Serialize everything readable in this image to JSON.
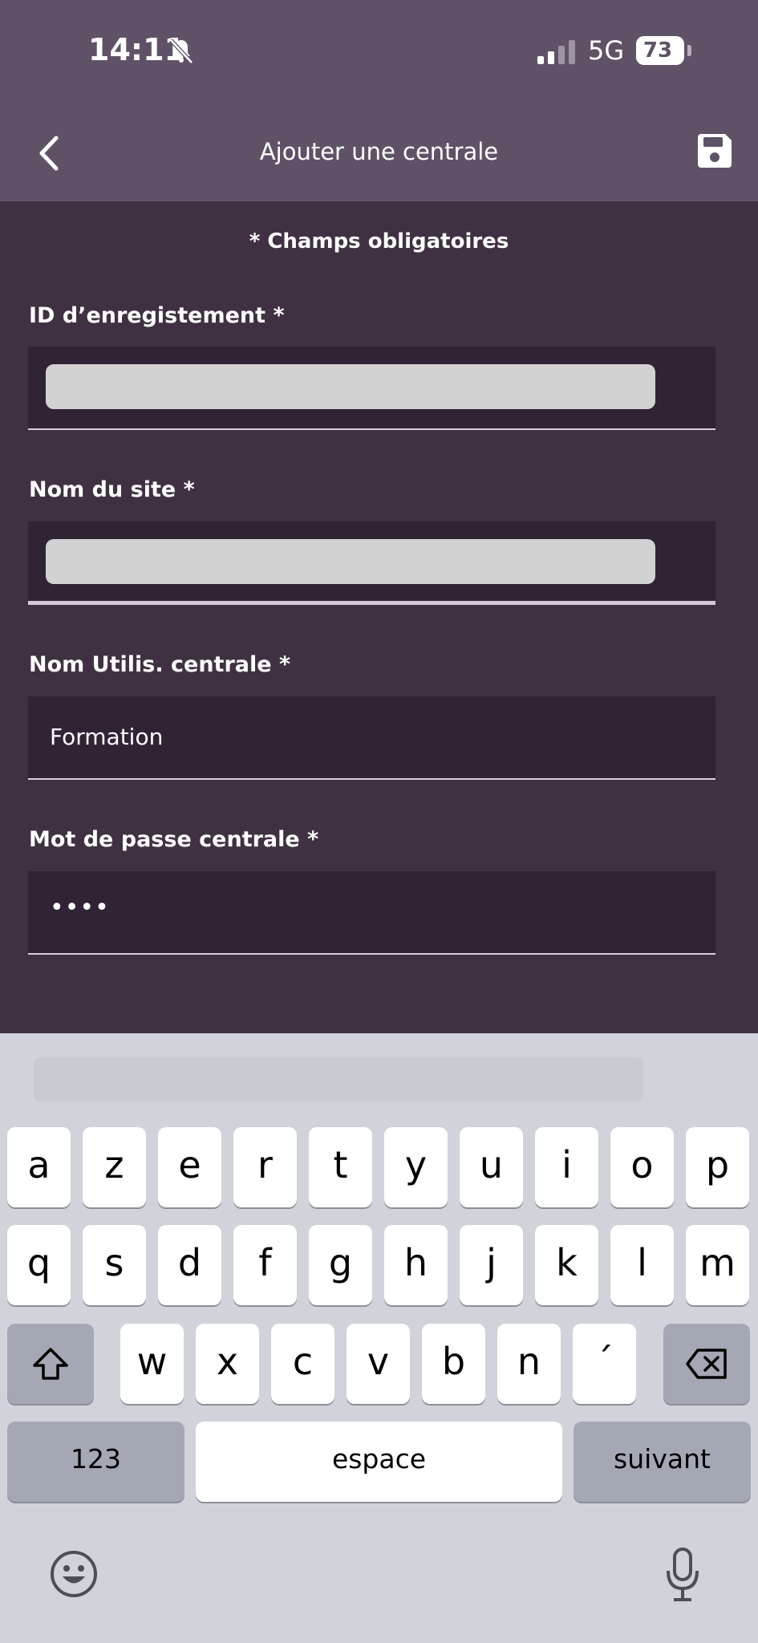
{
  "status": {
    "time": "14:11",
    "network": "5G",
    "battery": "73",
    "battery_level_percent": 73
  },
  "header": {
    "title": "Ajouter une centrale",
    "back_icon": "chevron-left-icon",
    "save_icon": "floppy-disk-icon"
  },
  "form": {
    "required_note": "* Champs obligatoires",
    "fields": [
      {
        "label": "ID d’enregistement *",
        "value": ""
      },
      {
        "label": "Nom du site *",
        "value": ""
      },
      {
        "label": "Nom Utilis. centrale *",
        "value": "Formation"
      },
      {
        "label": "Mot de passe centrale *",
        "value": "••••"
      }
    ]
  },
  "keyboard": {
    "row1": [
      "a",
      "z",
      "e",
      "r",
      "t",
      "y",
      "u",
      "i",
      "o",
      "p"
    ],
    "row2": [
      "q",
      "s",
      "d",
      "f",
      "g",
      "h",
      "j",
      "k",
      "l",
      "m"
    ],
    "row3": [
      "w",
      "x",
      "c",
      "v",
      "b",
      "n",
      "´"
    ],
    "numbers": "123",
    "space": "espace",
    "next": "suivant"
  },
  "colors": {
    "header_bg": "#5f5266",
    "content_bg": "#3f3142",
    "field_bg": "#2f2334",
    "keyboard_bg": "#d1d3db",
    "key_bg": "#ffffff",
    "key_dark_bg": "#a4a8b5"
  }
}
